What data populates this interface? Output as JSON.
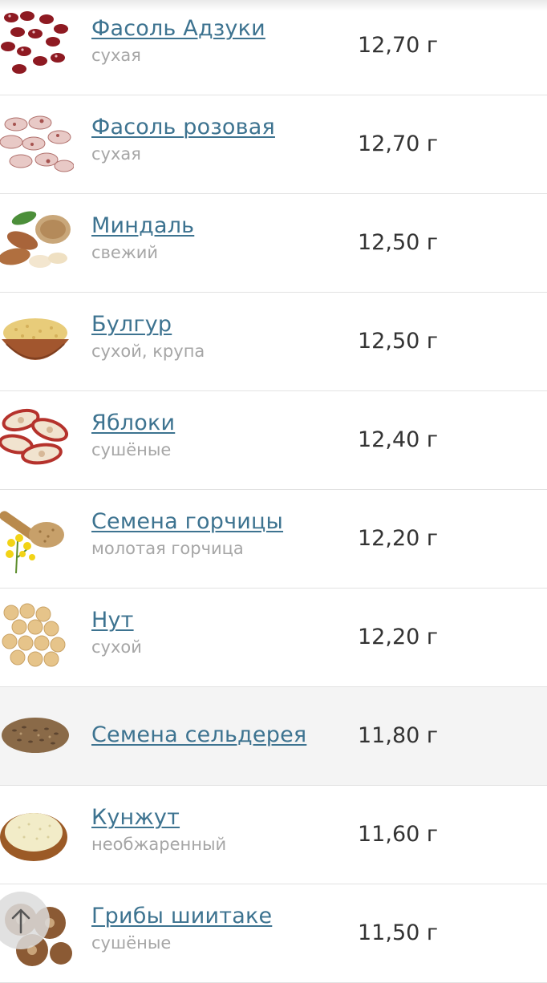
{
  "items": [
    {
      "name": "Фасоль Адзуки",
      "sub": "сухая",
      "value": "12,70 г",
      "icon": "adzuki-beans-image"
    },
    {
      "name": "Фасоль розовая",
      "sub": "сухая",
      "value": "12,70 г",
      "icon": "pink-beans-image"
    },
    {
      "name": "Миндаль",
      "sub": "свежий",
      "value": "12,50 г",
      "icon": "almond-image"
    },
    {
      "name": "Булгур",
      "sub": "сухой, крупа",
      "value": "12,50 г",
      "icon": "bulgur-image"
    },
    {
      "name": "Яблоки",
      "sub": "сушёные",
      "value": "12,40 г",
      "icon": "dried-apples-image"
    },
    {
      "name": "Семена горчицы",
      "sub": "молотая горчица",
      "value": "12,20 г",
      "icon": "mustard-seeds-image"
    },
    {
      "name": "Нут",
      "sub": "сухой",
      "value": "12,20 г",
      "icon": "chickpeas-image"
    },
    {
      "name": "Семена сельдерея",
      "sub": "",
      "value": "11,80 г",
      "icon": "celery-seeds-image"
    },
    {
      "name": "Кунжут",
      "sub": "необжаренный",
      "value": "11,60 г",
      "icon": "sesame-image"
    },
    {
      "name": "Грибы шиитаке",
      "sub": "сушёные",
      "value": "11,50 г",
      "icon": "shiitake-image"
    }
  ],
  "scroll_top_icon": "arrow-up-icon",
  "colors": {
    "link": "#3d7390",
    "subtitle": "#a6a6a6",
    "value": "#333333",
    "highlight_row": "#f4f4f4"
  }
}
